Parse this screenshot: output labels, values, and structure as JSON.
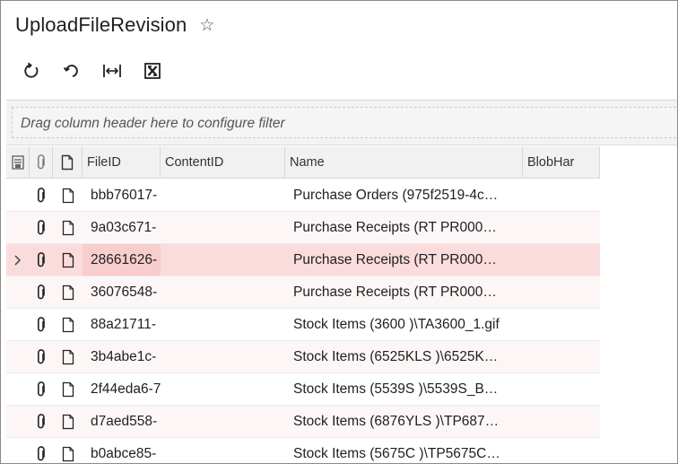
{
  "page": {
    "title": "UploadFileRevision"
  },
  "toolbar": {
    "buttons": [
      {
        "icon": "refresh-icon"
      },
      {
        "icon": "undo-icon"
      },
      {
        "icon": "fit-columns-icon"
      },
      {
        "icon": "excel-export-icon"
      }
    ]
  },
  "filter": {
    "placeholder": "Drag column header here to configure filter"
  },
  "table": {
    "columns": [
      "FileID",
      "ContentID",
      "Name",
      "BlobHar"
    ],
    "selected_row": 2,
    "rows": [
      {
        "fileid": "bbb76017-",
        "contentid": "",
        "name": "Purchase Orders (975f2519-4c…",
        "blob": ""
      },
      {
        "fileid": "9a03c671-",
        "contentid": "",
        "name": "Purchase Receipts (RT PR000…",
        "blob": ""
      },
      {
        "fileid": "28661626-",
        "contentid": "",
        "name": "Purchase Receipts (RT PR000…",
        "blob": ""
      },
      {
        "fileid": "36076548-",
        "contentid": "",
        "name": "Purchase Receipts (RT PR000…",
        "blob": ""
      },
      {
        "fileid": "88a21711-",
        "contentid": "",
        "name": "Stock Items (3600 )\\TA3600_1.gif",
        "blob": ""
      },
      {
        "fileid": "3b4abe1c-",
        "contentid": "",
        "name": "Stock Items (6525KLS )\\6525K…",
        "blob": ""
      },
      {
        "fileid": "2f44eda6-7",
        "contentid": "",
        "name": "Stock Items (5539S )\\5539S_B…",
        "blob": ""
      },
      {
        "fileid": "d7aed558-",
        "contentid": "",
        "name": "Stock Items (6876YLS )\\TP687…",
        "blob": ""
      },
      {
        "fileid": "b0abce85-",
        "contentid": "",
        "name": "Stock Items (5675C )\\TP5675C…",
        "blob": ""
      }
    ]
  }
}
